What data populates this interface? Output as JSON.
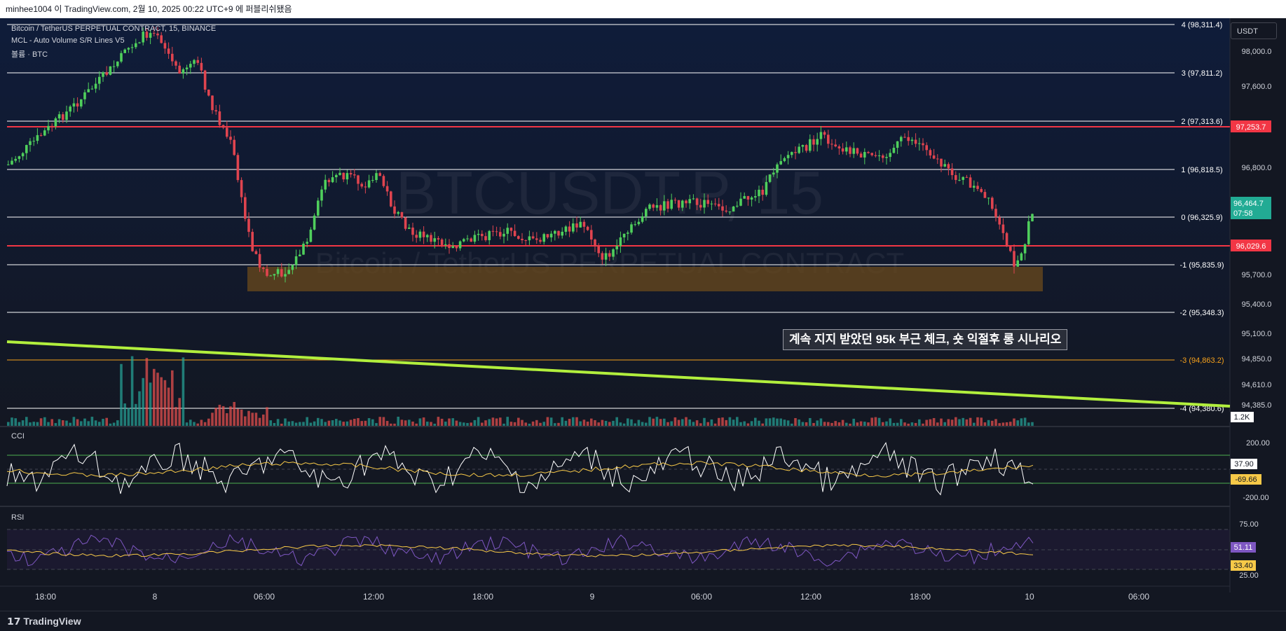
{
  "header": {
    "title": "minhee1004 이 TradingView.com, 2월 10, 2025 00:22 UTC+9 에 퍼블리쉬됐음"
  },
  "legend": {
    "symbol": "Bitcoin / TetherUS PERPETUAL CONTRACT, 15, BINANCE",
    "indicator": "MCL - Auto Volume S/R Lines V5",
    "volume": "볼륨 · BTC"
  },
  "currency_button": "USDT",
  "watermark": {
    "symbol": "BTCUSDT.P, 15",
    "description": "Bitcoin / TetherUS PERPETUAL CONTRACT"
  },
  "annotation": "계속 지지 받았던 95k 부근 체크, 숏 익절후 롱 시나리오",
  "price_axis_ticks": [
    "98,000.0",
    "97,600.0",
    "96,800.0",
    "95,700.0",
    "95,400.0",
    "95,100.0",
    "94,850.0",
    "94,610.0",
    "94,385.0"
  ],
  "levels": [
    {
      "label": "4 (98,311.4)",
      "color": "#ffffff"
    },
    {
      "label": "3 (97,811.2)",
      "color": "#ffffff"
    },
    {
      "label": "2 (97,313.6)",
      "color": "#ffffff"
    },
    {
      "label": "1 (96,818.5)",
      "color": "#ffffff"
    },
    {
      "label": "0 (96,325.9)",
      "color": "#ffffff"
    },
    {
      "label": "-1 (95,835.9)",
      "color": "#ffffff"
    },
    {
      "label": "-2 (95,348.3)",
      "color": "#ffffff"
    },
    {
      "label": "-3 (94,863.2)",
      "color": "#f7a21b"
    },
    {
      "label": "-4 (94,380.6)",
      "color": "#ffffff"
    }
  ],
  "price_badges": {
    "resistance": {
      "value": "97,253.7",
      "color": "#f23645"
    },
    "last_price": {
      "value": "96,464.7",
      "countdown": "07:58",
      "color": "#22ab94"
    },
    "support": {
      "value": "96,029.6",
      "color": "#f23645"
    }
  },
  "volume_badge": "1.2K",
  "cci": {
    "label": "CCI",
    "ticks": [
      "200.00",
      "-200.00"
    ],
    "value": "37.90",
    "ma_value": "-69.66"
  },
  "rsi": {
    "label": "RSI",
    "ticks": [
      "75.00",
      "25.00"
    ],
    "value": "51.11",
    "ma_value": "33.40"
  },
  "time_axis": [
    "18:00",
    "8",
    "06:00",
    "12:00",
    "18:00",
    "9",
    "06:00",
    "12:00",
    "18:00",
    "10",
    "06:00"
  ],
  "brand": "TradingView",
  "colors": {
    "background": "#131722",
    "up": "#4fcf5c",
    "down": "#e0444f",
    "trendline": "#b2ef3d",
    "support_zone": "#6b4a1c"
  }
}
